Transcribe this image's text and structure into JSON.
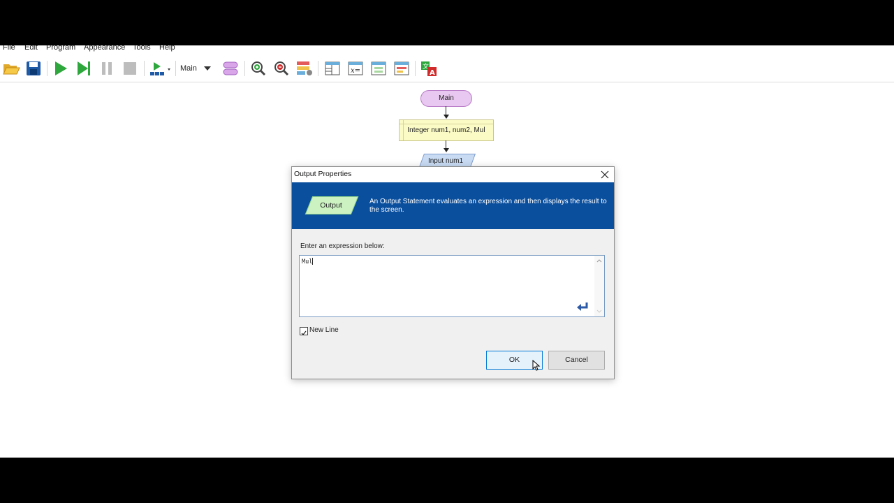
{
  "menu": [
    "File",
    "Edit",
    "Program",
    "Appearance",
    "Tools",
    "Help"
  ],
  "toolbar": {
    "function_selector": "Main",
    "icons": [
      "open-folder-icon",
      "save-icon",
      "run-icon",
      "step-icon",
      "pause-icon",
      "stop-icon",
      "run-speed-icon",
      "layout-icon",
      "zoom-in-icon",
      "zoom-out-icon",
      "chart-style-icon",
      "variables-panel-icon",
      "variable-watch-icon",
      "output-panel-icon",
      "console-panel-icon",
      "translate-icon"
    ]
  },
  "flowchart": {
    "start_label": "Main",
    "declare_label": "Integer num1, num2, Mul",
    "input_label": "Input num1"
  },
  "dialog": {
    "title": "Output Properties",
    "shape_label": "Output",
    "description": "An Output Statement evaluates an expression and then displays the result to the screen.",
    "prompt": "Enter an expression below:",
    "expression": "Mul",
    "newline_label": "New Line",
    "newline_checked": true,
    "ok_label": "OK",
    "cancel_label": "Cancel"
  },
  "colors": {
    "dialog_header": "#0a4f9e",
    "start_fill": "#e8c7f0",
    "declare_fill": "#fbfbc6",
    "input_fill": "#c8dbf3",
    "output_fill": "#ccf2c2"
  }
}
